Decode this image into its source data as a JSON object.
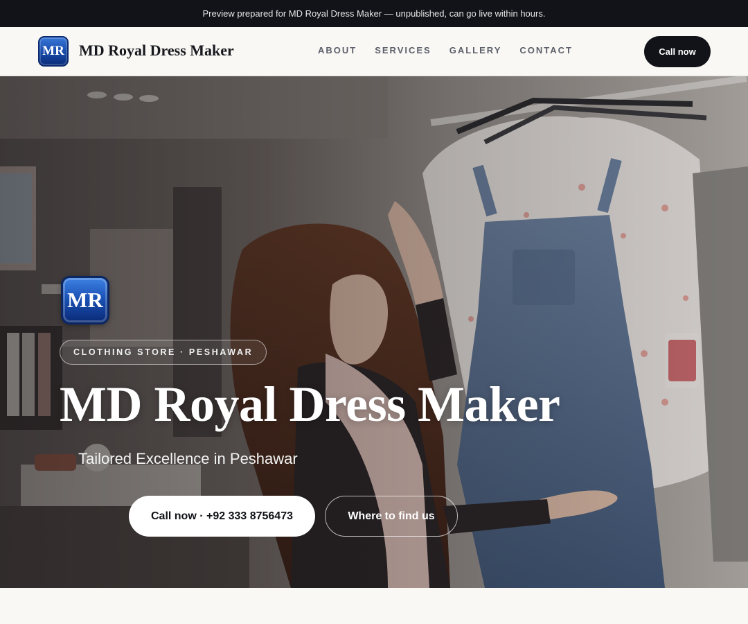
{
  "preview_banner": "Preview prepared for MD Royal Dress Maker — unpublished, can go live within hours.",
  "header": {
    "logo_text": "MR",
    "brand_name": "MD Royal Dress Maker",
    "nav": [
      {
        "label": "ABOUT"
      },
      {
        "label": "SERVICES"
      },
      {
        "label": "GALLERY"
      },
      {
        "label": "CONTACT"
      }
    ],
    "cta_label": "Call now"
  },
  "hero": {
    "logo_text": "MR",
    "tag": "CLOTHING STORE · PESHAWAR",
    "title": "MD Royal Dress Maker",
    "subtitle": "Tailored Excellence in Peshawar",
    "primary_button": "Call now · +92 333 8756473",
    "secondary_button": "Where to find us",
    "background": "photo of a woman browsing denim overalls and floral shirts on hangers in a clothing store"
  },
  "colors": {
    "dark": "#121318",
    "page_bg": "#faf8f4",
    "logo_blue": "#1a4fb0"
  }
}
